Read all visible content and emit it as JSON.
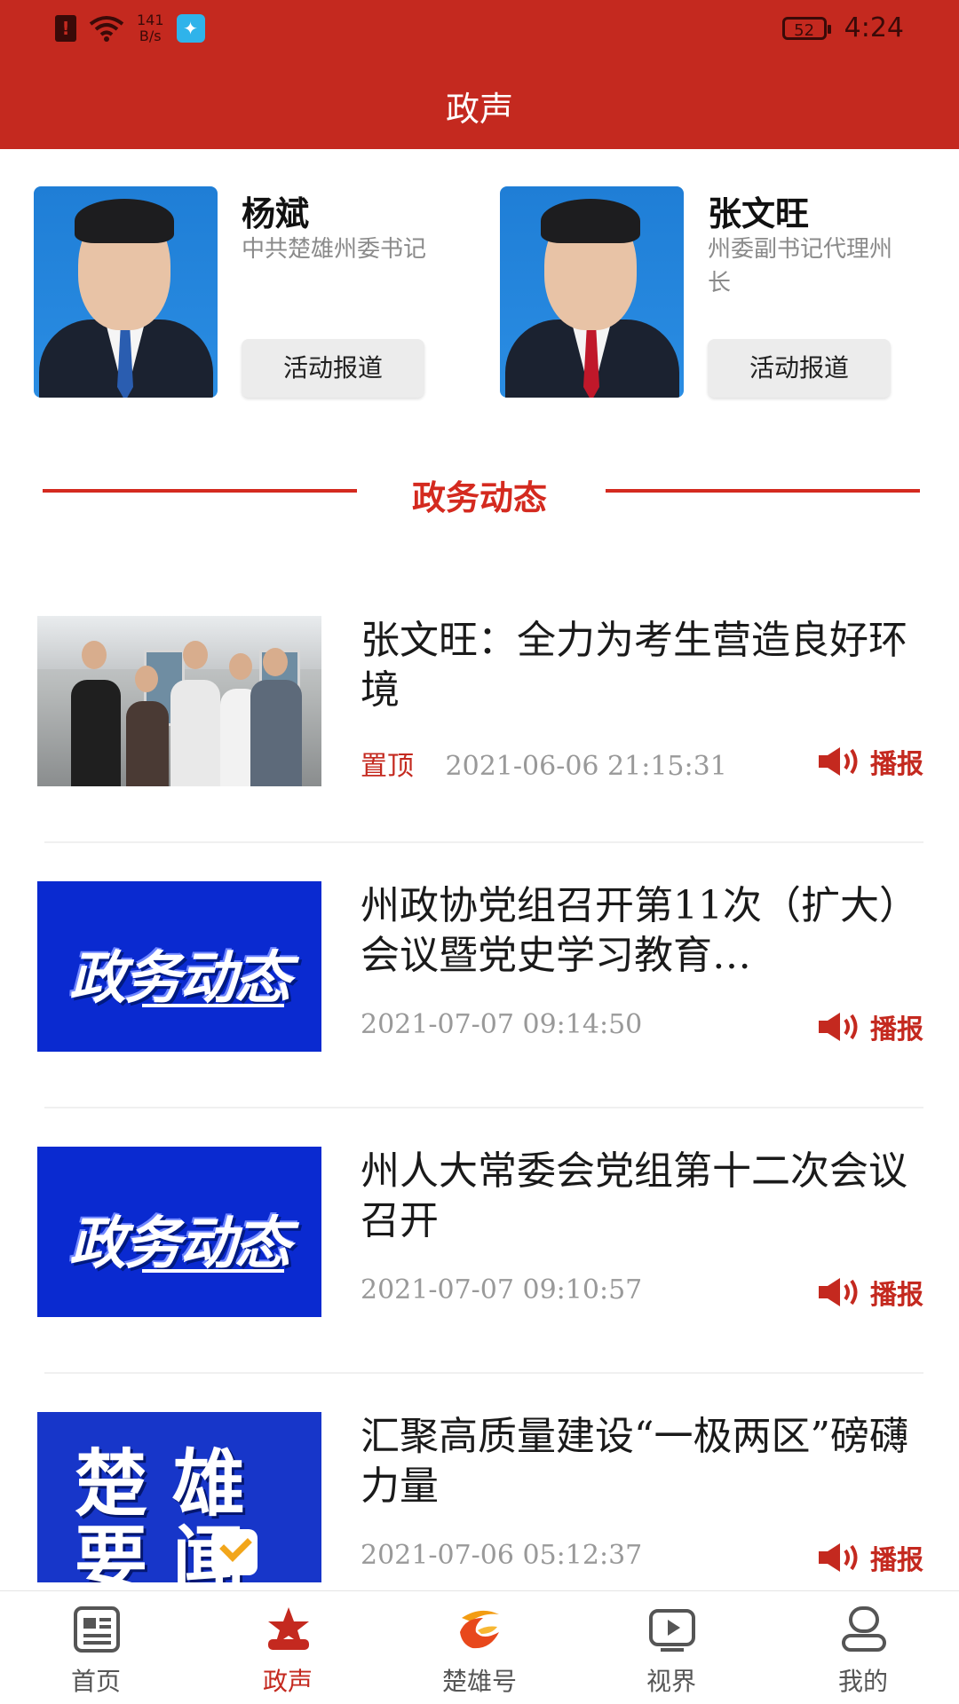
{
  "status_bar": {
    "net_speed_value": "141",
    "net_speed_unit": "B/s",
    "battery": "52",
    "time": "4:24"
  },
  "header": {
    "title": "政声"
  },
  "leaders": [
    {
      "name": "杨斌",
      "role": "中共楚雄州委书记",
      "button": "活动报道",
      "tie_color": "#2a5db0"
    },
    {
      "name": "张文旺",
      "role": "州委副书记代理州长",
      "button": "活动报道",
      "tie_color": "#c0182a"
    }
  ],
  "section": {
    "title": "政务动态"
  },
  "news": [
    {
      "thumb": "photo",
      "headline": "张文旺：全力为考生营造良好环境",
      "pinned": "置顶",
      "date": "2021-06-06 21:15:31",
      "broadcast": "播报"
    },
    {
      "thumb": "gov",
      "thumb_text": "政务动态",
      "headline": "州政协党组召开第11次（扩大）会议暨党史学习教育…",
      "pinned": "",
      "date": "2021-07-07 09:14:50",
      "broadcast": "播报"
    },
    {
      "thumb": "gov",
      "thumb_text": "政务动态",
      "headline": "州人大常委会党组第十二次会议召开",
      "pinned": "",
      "date": "2021-07-07 09:10:57",
      "broadcast": "播报"
    },
    {
      "thumb": "news",
      "thumb_text_1": "楚雄",
      "thumb_text_2": "要闻",
      "headline": "汇聚高质量建设“一极两区”磅礴力量",
      "pinned": "",
      "date": "2021-07-06 05:12:37",
      "broadcast": "播报"
    }
  ],
  "tabs": [
    {
      "label": "首页",
      "icon": "news-icon",
      "active": false
    },
    {
      "label": "政声",
      "icon": "star-icon",
      "active": true
    },
    {
      "label": "楚雄号",
      "icon": "chuxiong-logo-icon",
      "active": false
    },
    {
      "label": "视界",
      "icon": "video-icon",
      "active": false
    },
    {
      "label": "我的",
      "icon": "person-icon",
      "active": false
    }
  ],
  "colors": {
    "brand_red": "#c4291f",
    "accent_red": "#d42a1f"
  }
}
